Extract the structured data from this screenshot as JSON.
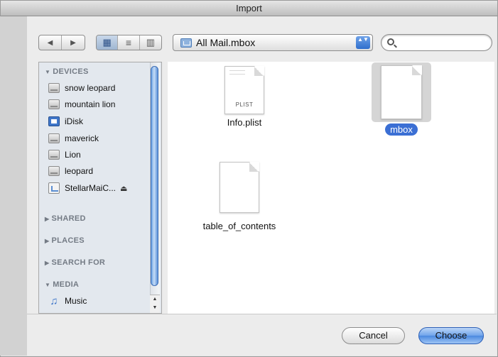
{
  "window": {
    "title": "Import"
  },
  "toolbar": {
    "back_glyph": "◀",
    "forward_glyph": "▶",
    "view_icon_glyph": "▦",
    "view_list_glyph": "≡",
    "view_column_glyph": "▥",
    "location": "All Mail.mbox",
    "popup_arrows": "▲▼",
    "search_placeholder": ""
  },
  "sidebar": {
    "devices_header": "DEVICES",
    "devices": [
      {
        "label": "snow leopard",
        "icon": "hard-disk-icon"
      },
      {
        "label": "mountain lion",
        "icon": "hard-disk-icon"
      },
      {
        "label": "iDisk",
        "icon": "idisk-icon"
      },
      {
        "label": "maverick",
        "icon": "hard-disk-icon"
      },
      {
        "label": "Lion",
        "icon": "hard-disk-icon"
      },
      {
        "label": "leopard",
        "icon": "hard-disk-icon"
      },
      {
        "label": "StellarMaiC...",
        "icon": "external-disk-icon",
        "eject": "⏏"
      }
    ],
    "shared_header": "SHARED",
    "places_header": "PLACES",
    "search_for_header": "SEARCH FOR",
    "media_header": "MEDIA",
    "media": [
      {
        "label": "Music",
        "icon": "music-note-icon"
      }
    ],
    "expanded_triangle": "▼",
    "collapsed_triangle": "▶"
  },
  "files": [
    {
      "name": "Info.plist",
      "badge": "PLIST",
      "selected": false
    },
    {
      "name": "mbox",
      "badge": "",
      "selected": true
    },
    {
      "name": "table_of_contents",
      "badge": "",
      "selected": false
    }
  ],
  "buttons": {
    "cancel": "Cancel",
    "choose": "Choose"
  },
  "colors": {
    "selection": "#3b6fd4",
    "sidebar_bg": "#e3e8ee",
    "default_button": "#6ea3ea"
  }
}
